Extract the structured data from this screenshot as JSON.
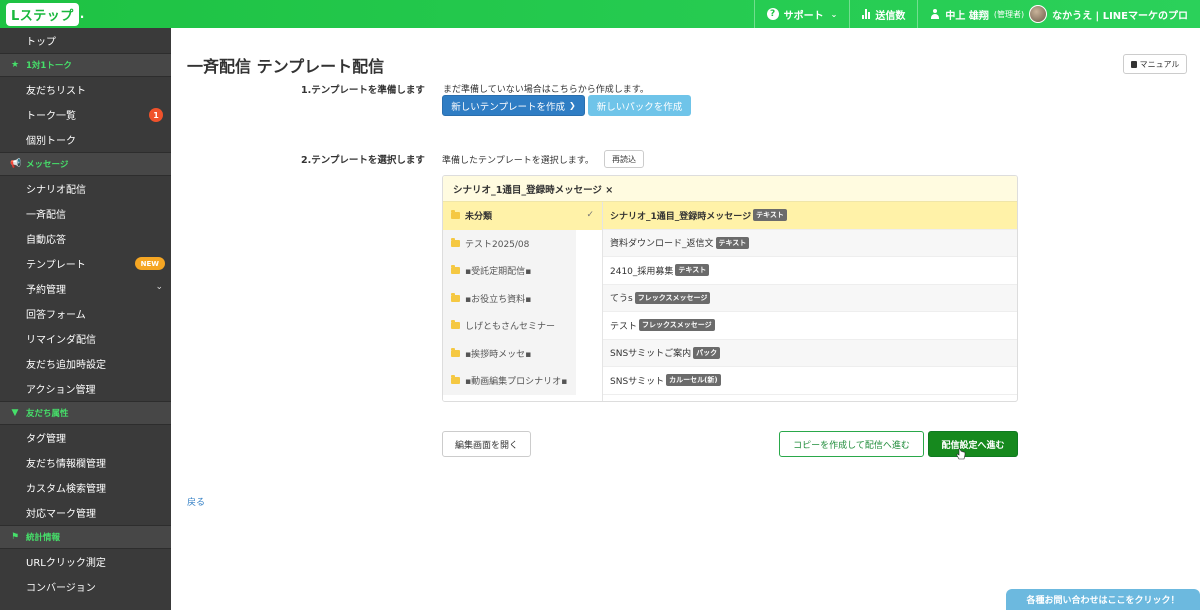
{
  "header": {
    "logo": "Lステップ",
    "support": "サポート",
    "sent_count": "送信数",
    "user_name": "中上 雄翔",
    "user_role": "(管理者)",
    "account": "なかうえ | LINEマーケのプロ",
    "colors": {
      "bar": "#1ec243"
    }
  },
  "sidebar": {
    "top": "トップ",
    "sections": [
      {
        "title": "1対1トーク",
        "icon": "star-icon",
        "items": [
          {
            "label": "友だちリスト"
          },
          {
            "label": "トーク一覧",
            "badge": "1"
          },
          {
            "label": "個別トーク"
          }
        ]
      },
      {
        "title": "メッセージ",
        "icon": "megaphone-icon",
        "items": [
          {
            "label": "シナリオ配信"
          },
          {
            "label": "一斉配信"
          },
          {
            "label": "自動応答"
          },
          {
            "label": "テンプレート",
            "badge": "NEW"
          },
          {
            "label": "予約管理"
          },
          {
            "label": "回答フォーム"
          },
          {
            "label": "リマインダ配信"
          },
          {
            "label": "友だち追加時設定"
          },
          {
            "label": "アクション管理"
          }
        ]
      },
      {
        "title": "友だち属性",
        "icon": "filter-icon",
        "items": [
          {
            "label": "タグ管理"
          },
          {
            "label": "友だち情報欄管理"
          },
          {
            "label": "カスタム検索管理"
          },
          {
            "label": "対応マーク管理"
          }
        ]
      },
      {
        "title": "統計情報",
        "icon": "flag-icon",
        "items": [
          {
            "label": "URLクリック測定"
          },
          {
            "label": "コンバージョン"
          }
        ]
      }
    ]
  },
  "main": {
    "title": "一斉配信 テンプレート配信",
    "manual": "マニュアル",
    "step1": {
      "label": "1.テンプレートを準備します",
      "hint": "まだ準備していない場合はこちらから作成します。",
      "new_template": "新しいテンプレートを作成",
      "new_pack": "新しいパックを作成"
    },
    "step2": {
      "label": "2.テンプレートを選択します",
      "hint": "準備したテンプレートを選択します。",
      "reload": "再読込"
    },
    "panel": {
      "selected": "シナリオ_1通目_登録時メッセージ ×",
      "folders": [
        {
          "name": "未分類",
          "selected": true
        },
        {
          "name": "テスト2025/08"
        },
        {
          "name": "▪受託定期配信▪"
        },
        {
          "name": "▪お役立ち資料▪"
        },
        {
          "name": "しげともさんセミナー"
        },
        {
          "name": "▪挨拶時メッセ▪"
        },
        {
          "name": "▪動画編集プロシナリオ▪"
        }
      ],
      "templates": [
        {
          "name": "シナリオ_1通目_登録時メッセージ",
          "tag": "テキスト",
          "selected": true
        },
        {
          "name": "資料ダウンロード_返信文",
          "tag": "テキスト"
        },
        {
          "name": "2410_採用募集",
          "tag": "テキスト"
        },
        {
          "name": "てうs",
          "tag": "フレックスメッセージ"
        },
        {
          "name": "テスト",
          "tag": "フレックスメッセージ"
        },
        {
          "name": "SNSサミットご案内",
          "tag": "パック"
        },
        {
          "name": "SNSサミット",
          "tag": "カルーセル(新)"
        }
      ]
    },
    "open_editor": "編集画面を開く",
    "copy_proceed": "コピーを作成して配信へ進む",
    "proceed": "配信設定へ進む",
    "back": "戻る"
  },
  "contact_bar": "各種お問い合わせはここをクリック！"
}
